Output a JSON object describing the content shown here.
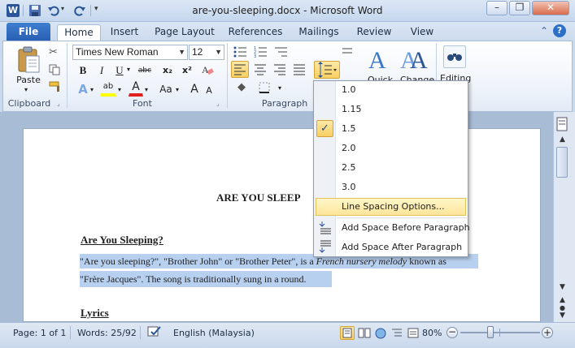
{
  "window": {
    "title": "are-you-sleeping.docx - Microsoft Word",
    "minimize_glyph": "–",
    "restore_glyph": "❐",
    "close_glyph": "✕"
  },
  "qat": {
    "app_icon": "W",
    "save_icon": "save-icon",
    "undo_icon": "undo-icon",
    "redo_icon": "redo-icon",
    "customize_icon": "customize-arrow-icon"
  },
  "tabs": [
    "File",
    "Home",
    "Insert",
    "Page Layout",
    "References",
    "Mailings",
    "Review",
    "View"
  ],
  "ribbon": {
    "clipboard": {
      "paste": "Paste",
      "label": "Clipboard"
    },
    "font": {
      "name": "Times New Roman",
      "size": "12",
      "label": "Font",
      "bold": "B",
      "italic": "I",
      "underline": "U",
      "strike": "abc",
      "subscript": "x₂",
      "superscript": "x²",
      "grow": "A",
      "shrink": "A",
      "change_case": "Aa",
      "text_effects": "A",
      "highlight": "ab",
      "font_color": "A"
    },
    "paragraph": {
      "label": "Paragraph"
    },
    "styles": {
      "quick": "Quick",
      "change": "Change"
    },
    "editing": {
      "label": "Editing"
    }
  },
  "document": {
    "heading": "ARE YOU SLEEP",
    "subheading": "Are You Sleeping?",
    "para_line1_a": "\"Are you sleeping?\", \"Brother John\" or \"Brother Peter\", is a ",
    "para_line1_italic": "French nursery melody",
    "para_line1_b": " known as",
    "para_line2": "\"Frère Jacques\". The song is traditionally sung in a round.",
    "lyrics": "Lyrics"
  },
  "line_spacing_menu": {
    "items": [
      "1.0",
      "1.15",
      "1.5",
      "2.0",
      "2.5",
      "3.0"
    ],
    "selected": "1.5",
    "check_glyph": "✓",
    "options": "Line Spacing Options...",
    "space_before": "Add Space Before Paragraph",
    "space_after": "Add Space After Paragraph"
  },
  "status": {
    "page": "Page: 1 of 1",
    "words": "Words: 25/92",
    "language": "English (Malaysia)",
    "zoom": "80%",
    "zoom_level_fraction": 0.8
  },
  "colors": {
    "accent": "#2b579a",
    "file_tab": "#2a5fb3",
    "selection": "#b8d0ef",
    "menu_highlight": "#fde59a"
  }
}
